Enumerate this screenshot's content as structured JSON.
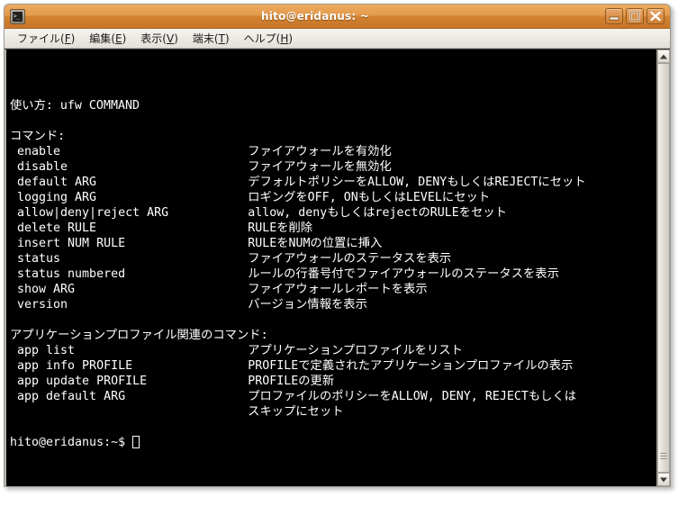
{
  "window": {
    "title": "hito@eridanus: ~",
    "icon": "terminal-icon",
    "buttons": [
      {
        "name": "minimize",
        "glyph": "minimize-icon"
      },
      {
        "name": "maximize",
        "glyph": "maximize-icon"
      },
      {
        "name": "close",
        "glyph": "close-icon"
      }
    ]
  },
  "menubar": [
    {
      "label": "ファイル",
      "accel": "F"
    },
    {
      "label": "編集",
      "accel": "E"
    },
    {
      "label": "表示",
      "accel": "V"
    },
    {
      "label": "端末",
      "accel": "T"
    },
    {
      "label": "ヘルプ",
      "accel": "H"
    }
  ],
  "terminal": {
    "colors": {
      "background": "#000000",
      "foreground": "#ffffff",
      "titlebar_start": "#eeab61",
      "titlebar_end": "#c8752c"
    },
    "usage_line": "使い方: ufw COMMAND",
    "section_commands_heading": "コマンド:",
    "commands": [
      {
        "cmd": "enable",
        "desc": "ファイアウォールを有効化"
      },
      {
        "cmd": "disable",
        "desc": "ファイアウォールを無効化"
      },
      {
        "cmd": "default ARG",
        "desc": "デフォルトポリシーをALLOW, DENYもしくはREJECTにセット"
      },
      {
        "cmd": "logging ARG",
        "desc": "ロギングをOFF, ONもしくはLEVELにセット"
      },
      {
        "cmd": "allow|deny|reject ARG",
        "desc": "allow, denyもしくはrejectのRULEをセット"
      },
      {
        "cmd": "delete RULE",
        "desc": "RULEを削除"
      },
      {
        "cmd": "insert NUM RULE",
        "desc": "RULEをNUMの位置に挿入"
      },
      {
        "cmd": "status",
        "desc": "ファイアウォールのステータスを表示"
      },
      {
        "cmd": "status numbered",
        "desc": "ルールの行番号付でファイアウォールのステータスを表示"
      },
      {
        "cmd": "show ARG",
        "desc": "ファイアウォールレポートを表示"
      },
      {
        "cmd": "version",
        "desc": "バージョン情報を表示"
      }
    ],
    "section_app_heading": "アプリケーションプロファイル関連のコマンド:",
    "app_commands": [
      {
        "cmd": "app list",
        "desc": "アプリケーションプロファイルをリスト"
      },
      {
        "cmd": "app info PROFILE",
        "desc": "PROFILEで定義されたアプリケーションプロファイルの表示"
      },
      {
        "cmd": "app update PROFILE",
        "desc": "PROFILEの更新"
      },
      {
        "cmd": "app default ARG",
        "desc": "プロファイルのポリシーをALLOW, DENY, REJECTもしくは"
      }
    ],
    "app_default_cont": "スキップにセット",
    "prompt": "hito@eridanus:~$ ",
    "cursor": "block"
  },
  "scrollbar": {
    "up_arrow": "scroll-up-icon",
    "down_arrow": "scroll-down-icon",
    "thumb_position_percent": 0
  }
}
